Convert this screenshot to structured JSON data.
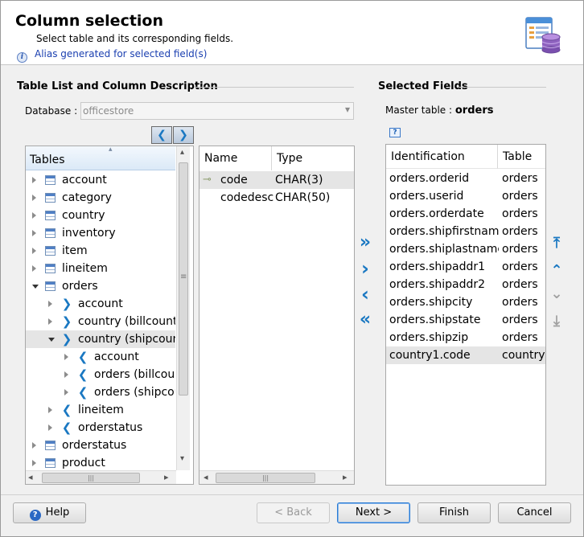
{
  "header": {
    "title": "Column selection",
    "subtitle": "Select table and its corresponding fields.",
    "alias_info": "Alias generated for selected field(s)"
  },
  "left": {
    "section_title": "Table List and Column Description",
    "database_label": "Database :",
    "database_value": "officestore",
    "tables_header": "Tables",
    "tree": [
      {
        "label": "account",
        "type": "table",
        "level": 0,
        "state": "closed"
      },
      {
        "label": "category",
        "type": "table",
        "level": 0,
        "state": "closed"
      },
      {
        "label": "country",
        "type": "table",
        "level": 0,
        "state": "closed"
      },
      {
        "label": "inventory",
        "type": "table",
        "level": 0,
        "state": "closed"
      },
      {
        "label": "item",
        "type": "table",
        "level": 0,
        "state": "closed"
      },
      {
        "label": "lineitem",
        "type": "table",
        "level": 0,
        "state": "closed"
      },
      {
        "label": "orders",
        "type": "table",
        "level": 0,
        "state": "open"
      },
      {
        "label": "account",
        "type": "fk-out",
        "level": 1,
        "state": "closed"
      },
      {
        "label": "country (billcountr",
        "type": "fk-out",
        "level": 1,
        "state": "closed"
      },
      {
        "label": "country (shipcount",
        "type": "fk-out",
        "level": 1,
        "state": "open",
        "selected": true
      },
      {
        "label": "account",
        "type": "fk-in",
        "level": 2,
        "state": "closed"
      },
      {
        "label": "orders (billcour",
        "type": "fk-in",
        "level": 2,
        "state": "closed"
      },
      {
        "label": "orders (shipcou",
        "type": "fk-in",
        "level": 2,
        "state": "closed"
      },
      {
        "label": "lineitem",
        "type": "fk-in",
        "level": 1,
        "state": "closed"
      },
      {
        "label": "orderstatus",
        "type": "fk-in",
        "level": 1,
        "state": "closed"
      },
      {
        "label": "orderstatus",
        "type": "table",
        "level": 0,
        "state": "closed"
      },
      {
        "label": "product",
        "type": "table",
        "level": 0,
        "state": "closed"
      }
    ],
    "columns_header_name": "Name",
    "columns_header_type": "Type",
    "columns": [
      {
        "name": "code",
        "type": "CHAR(3)",
        "key": true
      },
      {
        "name": "codedesc",
        "type": "CHAR(50)",
        "key": false
      }
    ]
  },
  "right": {
    "section_title": "Selected Fields",
    "master_label": "Master table :",
    "master_value": "orders",
    "help_icon": "?",
    "header_id": "Identification",
    "header_table": "Table",
    "fields": [
      {
        "id": "orders.orderid",
        "table": "orders"
      },
      {
        "id": "orders.userid",
        "table": "orders"
      },
      {
        "id": "orders.orderdate",
        "table": "orders"
      },
      {
        "id": "orders.shipfirstname",
        "table": "orders"
      },
      {
        "id": "orders.shiplastname",
        "table": "orders"
      },
      {
        "id": "orders.shipaddr1",
        "table": "orders"
      },
      {
        "id": "orders.shipaddr2",
        "table": "orders"
      },
      {
        "id": "orders.shipcity",
        "table": "orders"
      },
      {
        "id": "orders.shipstate",
        "table": "orders"
      },
      {
        "id": "orders.shipzip",
        "table": "orders"
      },
      {
        "id": "country1.code",
        "table": "country"
      }
    ]
  },
  "buttons": {
    "help": "Help",
    "back": "< Back",
    "next": "Next >",
    "finish": "Finish",
    "cancel": "Cancel"
  },
  "icons": {
    "nav_left": "❮",
    "nav_right": "❯",
    "add_all": "»",
    "add": "›",
    "remove": "‹",
    "remove_all": "«",
    "move_top": "⤒",
    "move_up": "⌃",
    "move_down": "⌄",
    "move_bottom": "⤓",
    "dropdown": "▾",
    "scroll_up": "▴",
    "scroll_down": "▾",
    "scroll_left": "◂",
    "scroll_right": "▸",
    "grip": "≡",
    "hgrip": "|||",
    "key": "⊸"
  },
  "colors": {
    "accent": "#1a78c2",
    "link": "#1a3fb0",
    "selection": "#e5e5e5"
  }
}
